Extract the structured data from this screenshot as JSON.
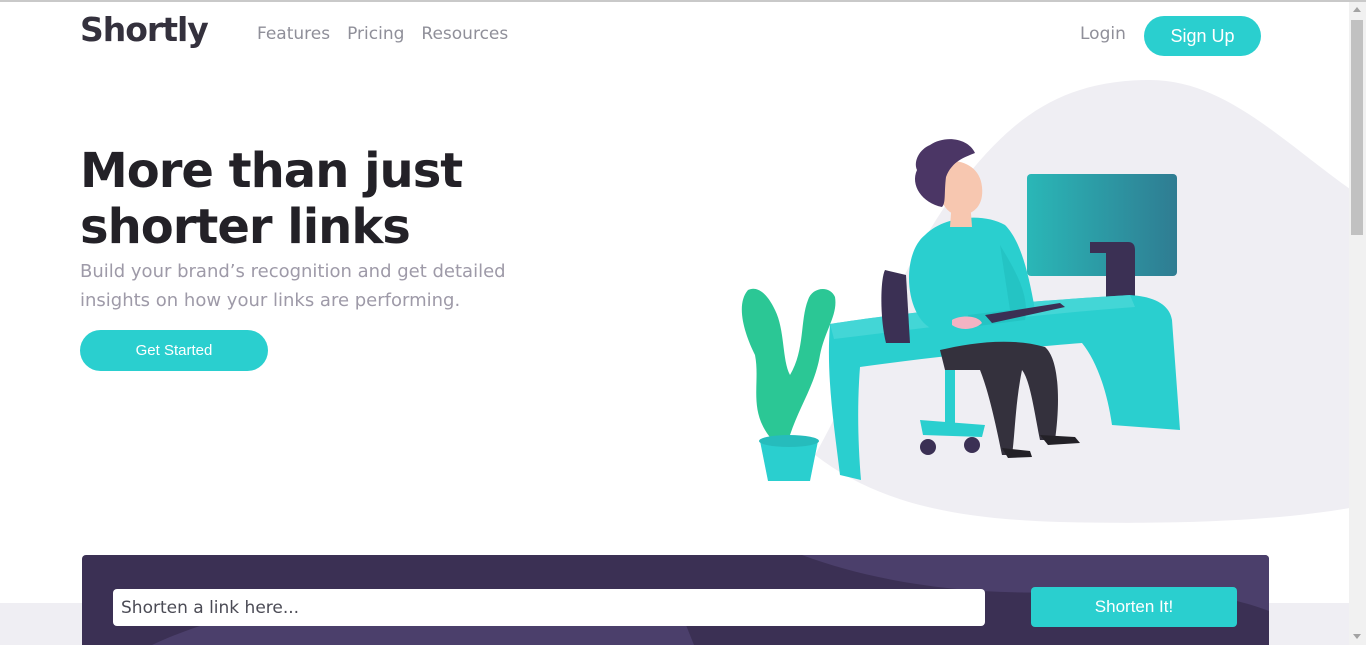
{
  "header": {
    "logo": "Shortly",
    "nav": [
      {
        "label": "Features"
      },
      {
        "label": "Pricing"
      },
      {
        "label": "Resources"
      }
    ],
    "login_label": "Login",
    "signup_label": "Sign Up"
  },
  "hero": {
    "title_line1": "More than just",
    "title_line2": "shorter links",
    "subtitle": "Build your brand’s recognition and get detailed insights on how your links are performing.",
    "cta_label": "Get Started",
    "illustration": "person-working-at-desk-illustration"
  },
  "shorten": {
    "placeholder": "Shorten a link here...",
    "value": "",
    "button_label": "Shorten It!"
  },
  "colors": {
    "accent": "#2acfcf",
    "dark_violet": "#3b3054",
    "heading": "#232127",
    "gray_text": "#9e9aa8"
  }
}
